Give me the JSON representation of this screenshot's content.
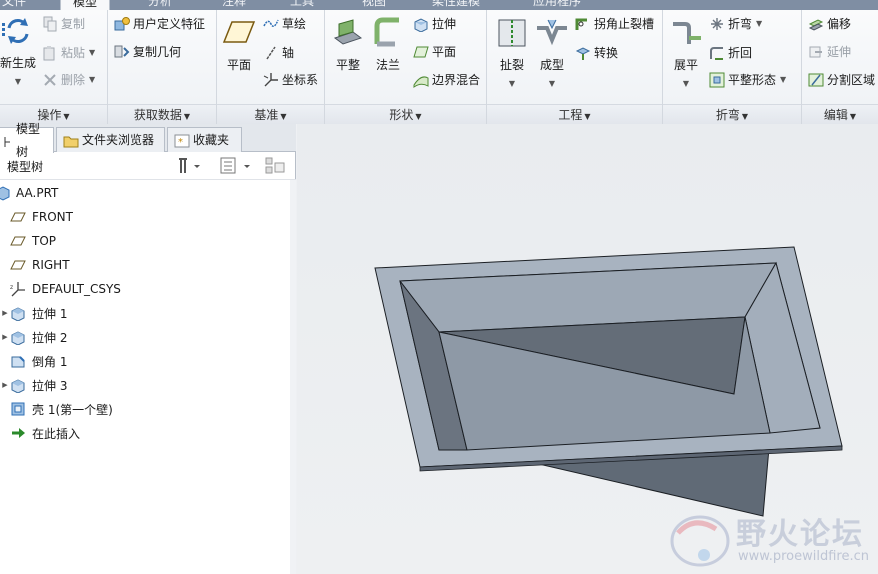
{
  "tabs": [
    {
      "label": "文件"
    },
    {
      "label": "模型"
    },
    {
      "label": "分析"
    },
    {
      "label": "注释"
    },
    {
      "label": "工具"
    },
    {
      "label": "视图"
    },
    {
      "label": "柔性建模"
    },
    {
      "label": "应用程序"
    }
  ],
  "ribbon": {
    "operations": {
      "title": "操作",
      "regenerate": "新生成",
      "copy": "复制",
      "paste": "粘贴",
      "delete": "删除"
    },
    "get_data": {
      "title": "获取数据",
      "udf": "用户定义特征",
      "copy_geometry": "复制几何"
    },
    "datum": {
      "title": "基准",
      "plane": "平面",
      "sketch": "草绘",
      "axis": "轴",
      "csys": "坐标系"
    },
    "shapes": {
      "title": "形状",
      "flat": "平整",
      "flange": "法兰",
      "extrude": "拉伸",
      "plane": "平面",
      "blend": "边界混合"
    },
    "engineering": {
      "title": "工程",
      "rip": "扯裂",
      "form": "成型",
      "corner_relief": "拐角止裂槽",
      "convert": "转换"
    },
    "bends": {
      "title": "折弯",
      "unbend": "展平",
      "bend": "折弯",
      "bend_back": "折回",
      "flat_pattern": "平整形态"
    },
    "editing": {
      "title": "编辑",
      "offset": "偏移",
      "extend": "延伸",
      "split_area": "分割区域"
    }
  },
  "panel": {
    "tabs": [
      {
        "label": "模型树"
      },
      {
        "label": "文件夹浏览器"
      },
      {
        "label": "收藏夹"
      }
    ],
    "header": "模型树",
    "tree": [
      {
        "label": "AA.PRT",
        "icon": "part-icon"
      },
      {
        "label": "FRONT",
        "icon": "datum-plane-icon"
      },
      {
        "label": "TOP",
        "icon": "datum-plane-icon"
      },
      {
        "label": "RIGHT",
        "icon": "datum-plane-icon"
      },
      {
        "label": "DEFAULT_CSYS",
        "icon": "csys-icon"
      },
      {
        "label": "拉伸 1",
        "icon": "extrude-icon"
      },
      {
        "label": "拉伸 2",
        "icon": "extrude-icon"
      },
      {
        "label": "倒角 1",
        "icon": "chamfer-icon"
      },
      {
        "label": "拉伸 3",
        "icon": "extrude-icon"
      },
      {
        "label": "壳 1(第一个壁)",
        "icon": "shell-icon"
      },
      {
        "label": "在此插入",
        "icon": "insert-arrow-icon"
      }
    ]
  },
  "watermark": {
    "cn": "野火论坛",
    "url": "www.proewildfire.cn"
  },
  "colors": {
    "accent": "#2f6fb5",
    "model_face_light": "#a9b4c1",
    "model_face_dark": "#5d6673",
    "model_edge": "#1b1f24"
  }
}
